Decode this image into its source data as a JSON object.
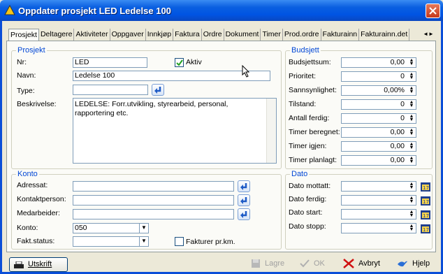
{
  "window": {
    "title": "Oppdater prosjekt LED Ledelse 100"
  },
  "tabs": [
    "Prosjekt",
    "Deltagere",
    "Aktiviteter",
    "Oppgaver",
    "Innkjøp",
    "Faktura",
    "Ordre",
    "Dokument",
    "Timer",
    "Prod.ordre",
    "Fakturainn",
    "Fakturainn.det"
  ],
  "tab_scroll": "◄►",
  "prosjekt": {
    "legend": "Prosjekt",
    "nr_label": "Nr:",
    "nr_value": "LED",
    "aktiv_label": "Aktiv",
    "aktiv_checked": true,
    "navn_label": "Navn:",
    "navn_value": "Ledelse 100",
    "type_label": "Type:",
    "type_value": "",
    "beskrivelse_label": "Beskrivelse:",
    "beskrivelse_value": "LEDELSE: Forr.utvikling, styrearbeid, personal, rapportering etc."
  },
  "budsjett": {
    "legend": "Budsjett",
    "rows": [
      {
        "label": "Budsjettsum:",
        "value": "0,00"
      },
      {
        "label": "Prioritet:",
        "value": "0"
      },
      {
        "label": "Sannsynlighet:",
        "value": "0,00%"
      },
      {
        "label": "Tilstand:",
        "value": "0"
      },
      {
        "label": "Antall ferdig:",
        "value": "0"
      },
      {
        "label": "Timer beregnet:",
        "value": "0,00"
      },
      {
        "label": "Timer igjen:",
        "value": "0,00"
      },
      {
        "label": "Timer planlagt:",
        "value": "0,00"
      }
    ]
  },
  "konto": {
    "legend": "Konto",
    "adressat_label": "Adressat:",
    "adressat_value": "",
    "kontaktperson_label": "Kontaktperson:",
    "kontaktperson_value": "",
    "medarbeider_label": "Medarbeider:",
    "medarbeider_value": "",
    "konto_label": "Konto:",
    "konto_value": "050",
    "faktstatus_label": "Fakt.status:",
    "faktstatus_value": "",
    "fakturer_label": "Fakturer pr.km.",
    "fakturer_checked": false
  },
  "dato": {
    "legend": "Dato",
    "rows": [
      {
        "label": "Dato mottatt:",
        "value": ""
      },
      {
        "label": "Dato ferdig:",
        "value": ""
      },
      {
        "label": "Dato start:",
        "value": ""
      },
      {
        "label": "Dato stopp:",
        "value": ""
      }
    ]
  },
  "buttons": {
    "print": "Utskrift",
    "save": "Lagre",
    "ok": "OK",
    "cancel": "Avbryt",
    "help": "Hjelp"
  },
  "colors": {
    "title_bar": "#0054e3",
    "group_legend": "#0046d5",
    "cancel_red": "#d01010"
  }
}
